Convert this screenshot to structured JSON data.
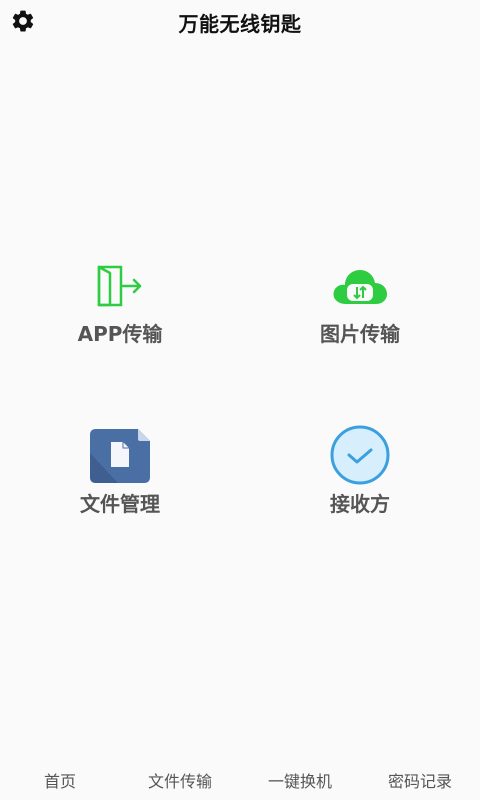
{
  "header": {
    "title": "万能无线钥匙",
    "settings_icon": "gear-icon"
  },
  "tiles": [
    {
      "label": "APP传输",
      "icon": "exit-door-arrow-icon",
      "color": "#2ecc40"
    },
    {
      "label": "图片传输",
      "icon": "cloud-transfer-icon",
      "color": "#2ecc40"
    },
    {
      "label": "文件管理",
      "icon": "document-icon",
      "color": "#4a6fa5"
    },
    {
      "label": "接收方",
      "icon": "checkmark-circle-icon",
      "color": "#3aa0e0"
    }
  ],
  "bottom_nav": {
    "items": [
      {
        "label": "首页"
      },
      {
        "label": "文件传输"
      },
      {
        "label": "一键换机"
      },
      {
        "label": "密码记录"
      }
    ]
  }
}
